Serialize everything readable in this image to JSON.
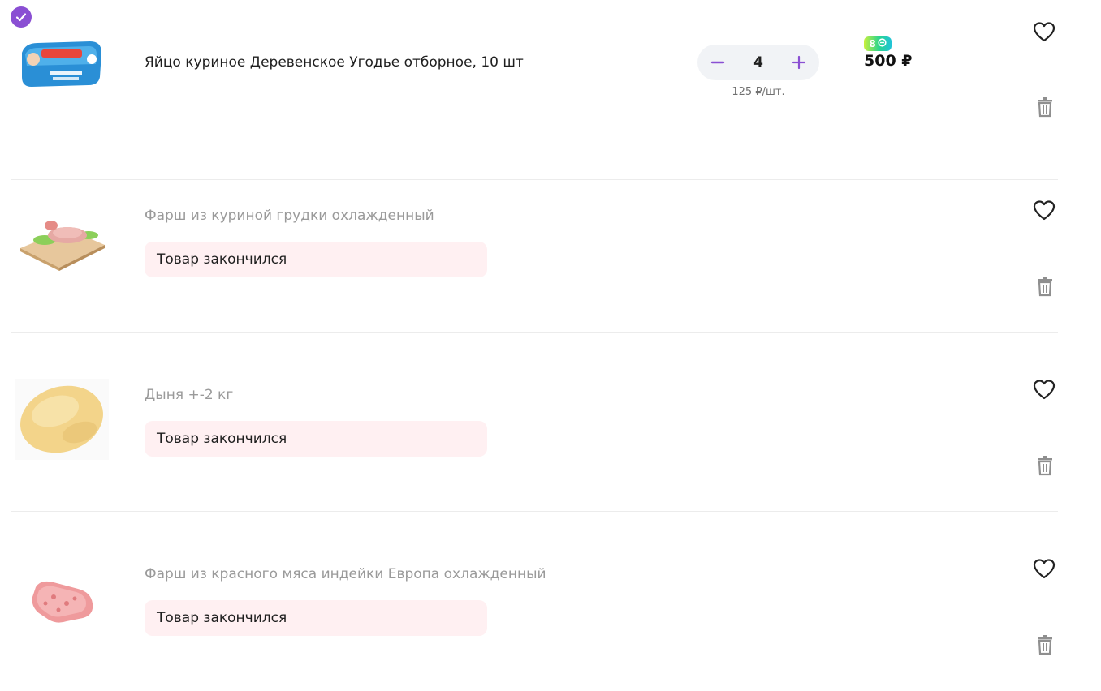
{
  "cart": {
    "items": [
      {
        "title": "Яйцо куриное Деревенское Угодье отборное, 10 шт",
        "available": true,
        "quantity": "4",
        "unit_price": "125 ₽/шт.",
        "badge_value": "8",
        "price": "500 ₽",
        "image_label": "egg-carton-image"
      },
      {
        "title": "Фарш из куриной грудки охлажденный",
        "available": false,
        "status": "Товар закончился",
        "image_label": "chicken-mince-image"
      },
      {
        "title": "Дыня +-2 кг",
        "available": false,
        "status": "Товар закончился",
        "image_label": "melon-image"
      },
      {
        "title": "Фарш из красного мяса индейки Европа охлажденный",
        "available": false,
        "status": "Товар закончился",
        "image_label": "turkey-mince-image"
      }
    ]
  },
  "colors": {
    "accent": "#8a4fd3",
    "oos_bg": "#fff0f2",
    "stepper_bg": "#f1f3f6"
  },
  "icons": [
    "check-icon",
    "minus-icon",
    "plus-icon",
    "heart-icon",
    "trash-icon",
    "points-badge-icon"
  ]
}
